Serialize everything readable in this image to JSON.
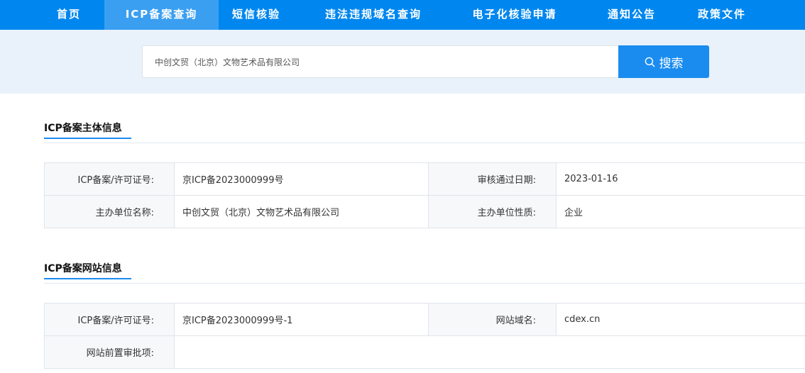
{
  "nav": {
    "items": [
      "首页",
      "ICP备案查询",
      "短信核验",
      "违法违规域名查询",
      "电子化核验申请",
      "通知公告",
      "政策文件"
    ],
    "active": "ICP备案查询"
  },
  "search": {
    "value": "中创文贸（北京）文物艺术品有限公司",
    "button_label": "搜索"
  },
  "subject_section": {
    "title": "ICP备案主体信息",
    "license_label": "ICP备案/许可证号:",
    "license_value": "京ICP备2023000999号",
    "approval_date_label": "审核通过日期:",
    "approval_date_value": "2023-01-16",
    "org_name_label": "主办单位名称:",
    "org_name_value": "中创文贸（北京）文物艺术品有限公司",
    "org_type_label": "主办单位性质:",
    "org_type_value": "企业"
  },
  "website_section": {
    "title": "ICP备案网站信息",
    "license_label": "ICP备案/许可证号:",
    "license_value": "京ICP备2023000999号-1",
    "domain_label": "网站域名:",
    "domain_value": "cdex.cn",
    "preapproval_label": "网站前置审批项:",
    "preapproval_value": ""
  },
  "colors": {
    "nav_bg": "#0087ef",
    "nav_active_bg": "#3a9ff1",
    "search_band_bg": "#e9f2fb",
    "accent": "#1a8cf0"
  },
  "icons": {
    "search": "search-icon"
  }
}
